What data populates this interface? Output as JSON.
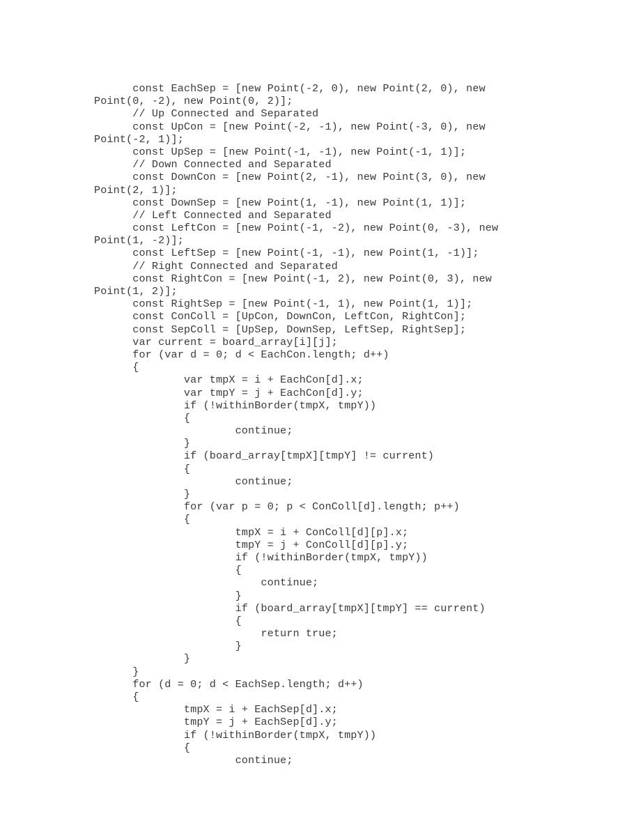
{
  "document": {
    "kind": "code-listing",
    "language": "javascript",
    "page_background": "#ffffff",
    "ink_color": "#3a3a3a",
    "lines": [
      "      const EachSep = [new Point(-2, 0), new Point(2, 0), new",
      "Point(0, -2), new Point(0, 2)];",
      "      // Up Connected and Separated",
      "      const UpCon = [new Point(-2, -1), new Point(-3, 0), new",
      "Point(-2, 1)];",
      "      const UpSep = [new Point(-1, -1), new Point(-1, 1)];",
      "      // Down Connected and Separated",
      "      const DownCon = [new Point(2, -1), new Point(3, 0), new",
      "Point(2, 1)];",
      "      const DownSep = [new Point(1, -1), new Point(1, 1)];",
      "      // Left Connected and Separated",
      "      const LeftCon = [new Point(-1, -2), new Point(0, -3), new",
      "Point(1, -2)];",
      "      const LeftSep = [new Point(-1, -1), new Point(1, -1)];",
      "      // Right Connected and Separated",
      "      const RightCon = [new Point(-1, 2), new Point(0, 3), new",
      "Point(1, 2)];",
      "      const RightSep = [new Point(-1, 1), new Point(1, 1)];",
      "      const ConColl = [UpCon, DownCon, LeftCon, RightCon];",
      "      const SepColl = [UpSep, DownSep, LeftSep, RightSep];",
      "      var current = board_array[i][j];",
      "      for (var d = 0; d < EachCon.length; d++)",
      "      {",
      "              var tmpX = i + EachCon[d].x;",
      "              var tmpY = j + EachCon[d].y;",
      "              if (!withinBorder(tmpX, tmpY))",
      "              {",
      "                      continue;",
      "              }",
      "              if (board_array[tmpX][tmpY] != current)",
      "              {",
      "                      continue;",
      "              }",
      "              for (var p = 0; p < ConColl[d].length; p++)",
      "              {",
      "                      tmpX = i + ConColl[d][p].x;",
      "                      tmpY = j + ConColl[d][p].y;",
      "                      if (!withinBorder(tmpX, tmpY))",
      "                      {",
      "                          continue;",
      "                      }",
      "                      if (board_array[tmpX][tmpY] == current)",
      "                      {",
      "                          return true;",
      "                      }",
      "              }",
      "      }",
      "      for (d = 0; d < EachSep.length; d++)",
      "      {",
      "              tmpX = i + EachSep[d].x;",
      "              tmpY = j + EachSep[d].y;",
      "              if (!withinBorder(tmpX, tmpY))",
      "              {",
      "                      continue;"
    ]
  }
}
